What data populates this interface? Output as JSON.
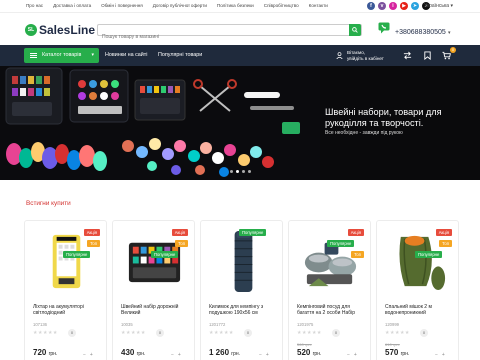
{
  "topbar": {
    "links": [
      "Про нас",
      "Доставка і оплата",
      "Обмін і повернення",
      "Договір публічної оферти",
      "Політика безпеки",
      "Співробітництво",
      "Контакти"
    ],
    "socials": [
      {
        "name": "facebook-icon",
        "glyph": "f",
        "color": "#3b5998"
      },
      {
        "name": "viber-icon",
        "glyph": "v",
        "color": "#7b519d"
      },
      {
        "name": "instagram-icon",
        "glyph": "i",
        "color": "#d6249f"
      },
      {
        "name": "youtube-icon",
        "glyph": "▶",
        "color": "#e62117"
      },
      {
        "name": "telegram-icon",
        "glyph": "➤",
        "color": "#2aa3df"
      },
      {
        "name": "tiktok-icon",
        "glyph": "♪",
        "color": "#111111"
      }
    ],
    "language": "Українська"
  },
  "header": {
    "logo_mark": "SL",
    "logo_text": "SalesLine",
    "search_placeholder": "Пошук товару в магазині",
    "phone": "+380688380505"
  },
  "nav": {
    "catalog_label": "Каталог товарів",
    "links": [
      "Новинки на сайті",
      "Популярні товари"
    ],
    "login_line1": "Вітаємо,",
    "login_line2": "увійдіть в кабінет",
    "cart_count": "0"
  },
  "hero": {
    "title": "Швейні набори, товари для рукоділля та творчості.",
    "subtitle": "Все необхідне - завжди під рукою",
    "slides": 4,
    "active_slide": 1
  },
  "section": {
    "title": "Встигни купити"
  },
  "products": [
    {
      "name": "Ліхтар на акумуляторі світлодіодний",
      "code": "107136",
      "old_price": "",
      "price": "720",
      "currency": "грн.",
      "badges": [
        "Акція",
        "Топ",
        "Популярне"
      ],
      "reviews": "0",
      "image": "lantern"
    },
    {
      "name": "Швейний набір дорожній Великий",
      "code": "10035",
      "old_price": "",
      "price": "430",
      "currency": "грн.",
      "badges": [
        "Акція",
        "Топ",
        "Популярне"
      ],
      "reviews": "0",
      "image": "sewing-kit"
    },
    {
      "name": "Килимок для кемпінгу з подушкою 190х56 см",
      "code": "1201772",
      "old_price": "",
      "price": "1 260",
      "currency": "грн.",
      "badges": [
        "Популярне"
      ],
      "reviews": "0",
      "image": "camping-mat"
    },
    {
      "name": "Кемпінговий посуд для багаття на 2 особи Набір",
      "code": "1201975",
      "old_price": "560 грн.",
      "price": "520",
      "currency": "грн.",
      "badges": [
        "Акція",
        "Популярне",
        "Топ"
      ],
      "reviews": "0",
      "image": "cookware"
    },
    {
      "name": "Спальний мішок 2 м водонепроникний",
      "code": "120999",
      "old_price": "610 грн.",
      "price": "570",
      "currency": "грн.",
      "badges": [
        "Акція",
        "Топ",
        "Популярне"
      ],
      "reviews": "0",
      "image": "sleeping-bag"
    }
  ],
  "colors": {
    "brand_green": "#27ae4b",
    "nav_dark": "#1f2a3c",
    "sale_red": "#e74c3c",
    "top_orange": "#f5a623",
    "section_red": "#d3312f"
  }
}
